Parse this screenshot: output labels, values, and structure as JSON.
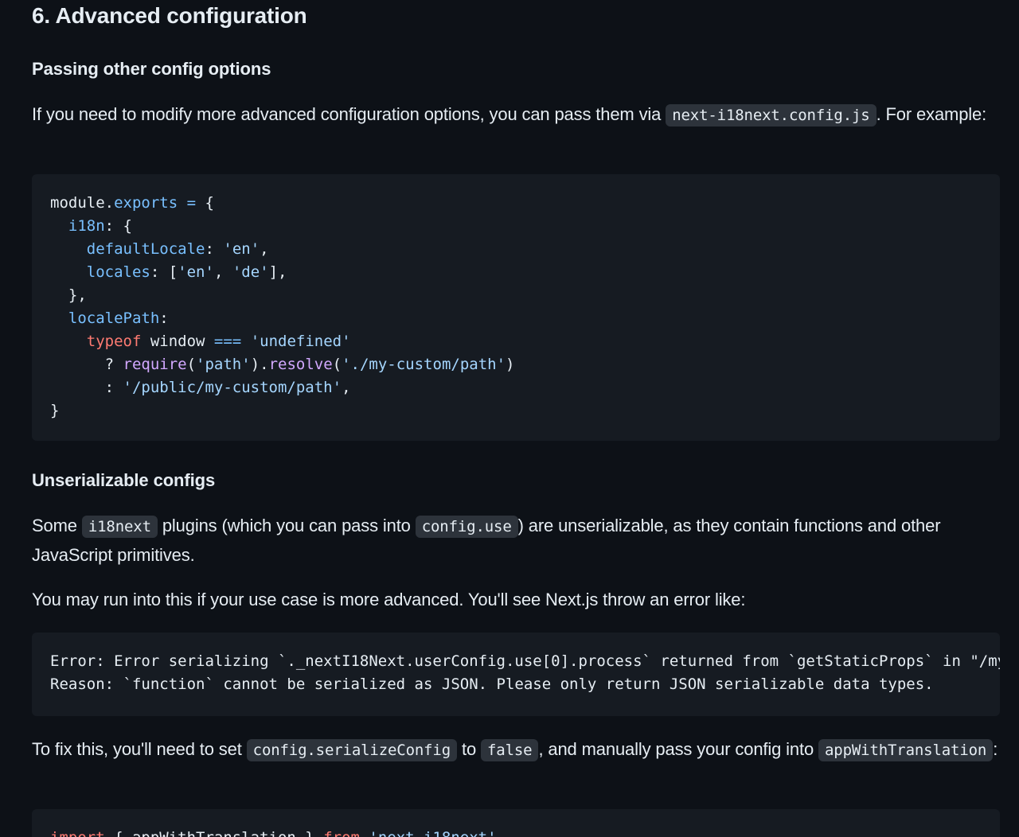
{
  "section": {
    "heading": "6. Advanced configuration"
  },
  "passing": {
    "heading": "Passing other config options",
    "para_before": "If you need to modify more advanced configuration options, you can pass them via ",
    "para_code": "next-i18next.config.js",
    "para_after": ". For example:",
    "code_lines": {
      "l1_a": "module.",
      "l1_b": "exports",
      "l1_c": " ",
      "l1_d": "=",
      "l1_e": " {",
      "l2_a": "  ",
      "l2_b": "i18n",
      "l2_c": ": {",
      "l3_a": "    ",
      "l3_b": "defaultLocale",
      "l3_c": ": ",
      "l3_d": "'en'",
      "l3_e": ",",
      "l4_a": "    ",
      "l4_b": "locales",
      "l4_c": ": [",
      "l4_d": "'en'",
      "l4_e": ", ",
      "l4_f": "'de'",
      "l4_g": "],",
      "l5": "  },",
      "l6_a": "  ",
      "l6_b": "localePath",
      "l6_c": ":",
      "l7_a": "    ",
      "l7_b": "typeof",
      "l7_c": " window ",
      "l7_d": "===",
      "l7_e": " ",
      "l7_f": "'undefined'",
      "l8_a": "      ? ",
      "l8_b": "require",
      "l8_c": "(",
      "l8_d": "'path'",
      "l8_e": ").",
      "l8_f": "resolve",
      "l8_g": "(",
      "l8_h": "'./my-custom/path'",
      "l8_i": ")",
      "l9_a": "      : ",
      "l9_b": "'/public/my-custom/path'",
      "l9_c": ",",
      "l10": "}"
    }
  },
  "unserializable": {
    "heading": "Unserializable configs",
    "p1_a": "Some ",
    "p1_code1": "i18next",
    "p1_b": " plugins (which you can pass into ",
    "p1_code2": "config.use",
    "p1_c": ") are unserializable, as they contain functions and other JavaScript primitives.",
    "p2": "You may run into this if your use case is more advanced. You'll see Next.js throw an error like:",
    "error_line1": "Error: Error serializing `._nextI18Next.userConfig.use[0].process` returned from `getStaticProps` in \"/my-page\".",
    "error_line2": "Reason: `function` cannot be serialized as JSON. Please only return JSON serializable data types.",
    "p3_a": "To fix this, you'll need to set ",
    "p3_code1": "config.serializeConfig",
    "p3_b": " to ",
    "p3_code2": "false",
    "p3_c": ", and manually pass your config into ",
    "p3_code3": "appWithTranslation",
    "p3_d": ":"
  },
  "next_code": {
    "l1_a": "import",
    "l1_b": " { appWithTranslation } ",
    "l1_c": "from",
    "l1_d": " ",
    "l1_e": "'next-i18next'"
  }
}
